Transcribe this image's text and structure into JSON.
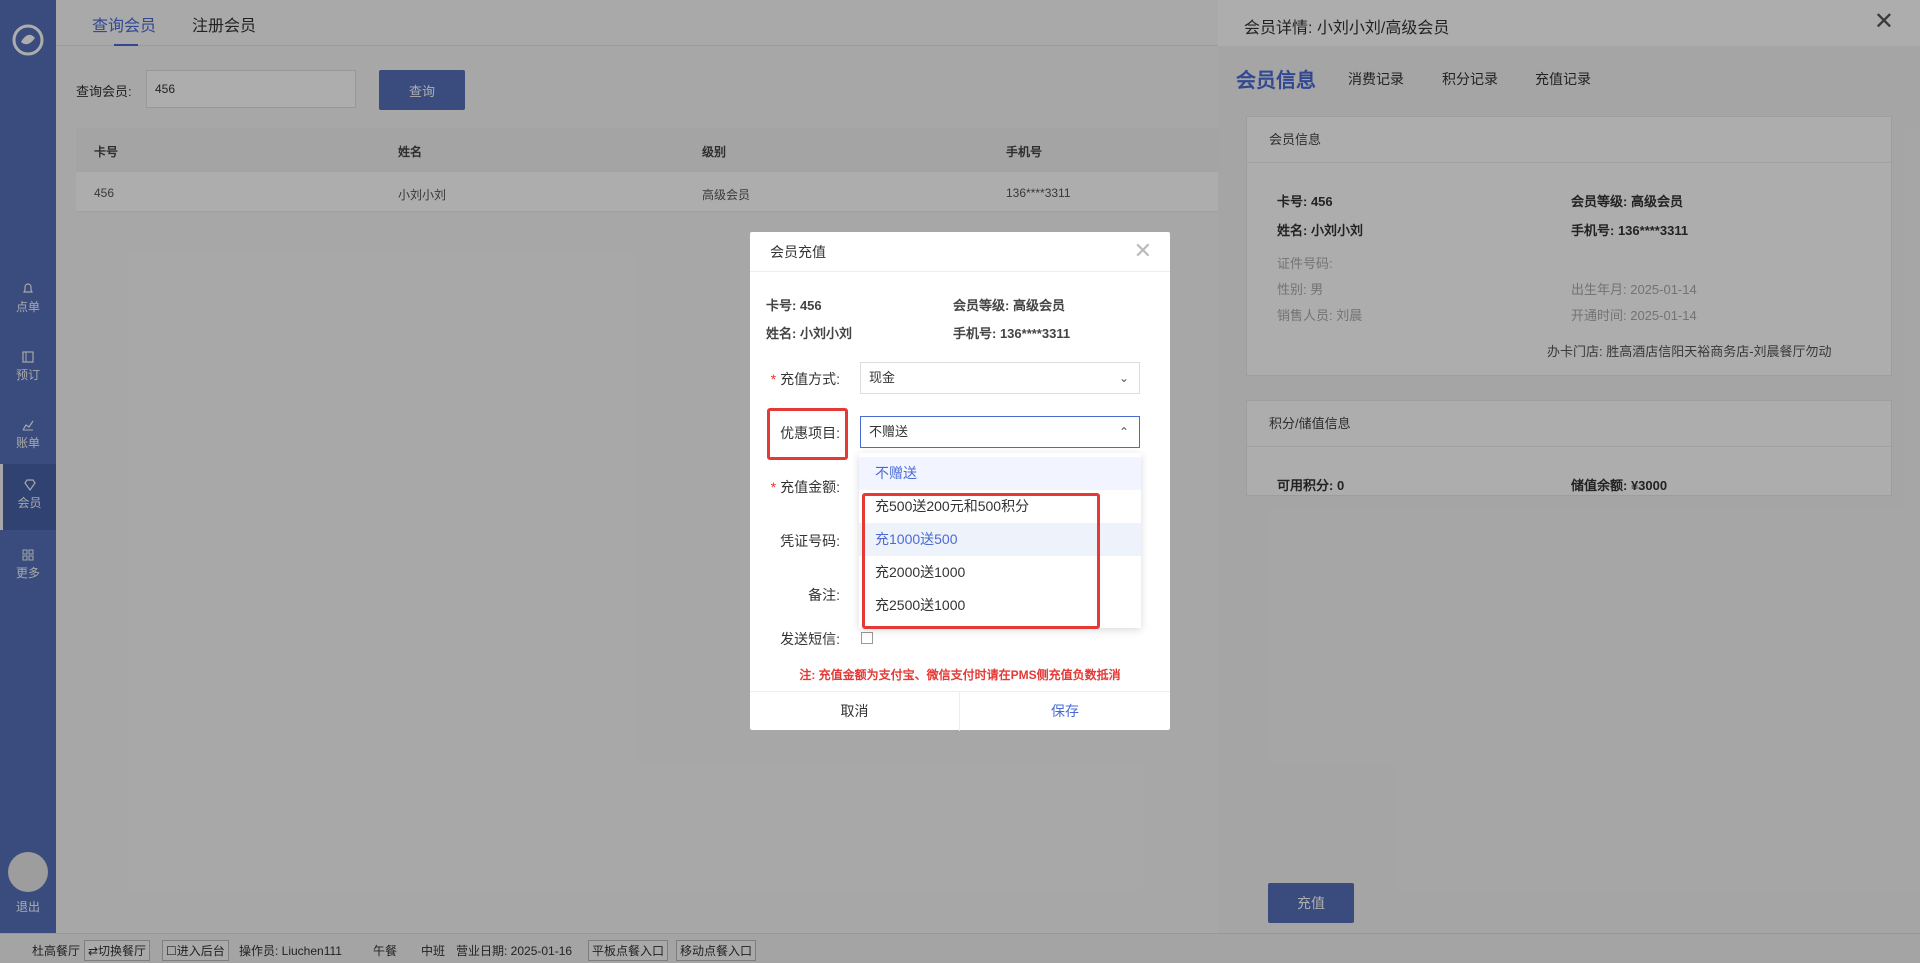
{
  "sidebar": {
    "items": [
      {
        "label": "点单",
        "icon": "bell-icon"
      },
      {
        "label": "预订",
        "icon": "book-icon"
      },
      {
        "label": "账单",
        "icon": "chart-icon"
      },
      {
        "label": "会员",
        "icon": "diamond-icon"
      },
      {
        "label": "更多",
        "icon": "grid-icon"
      }
    ],
    "logout_label": "退出"
  },
  "main": {
    "tabs": [
      "查询会员",
      "注册会员"
    ],
    "search_label": "查询会员:",
    "search_value": "456",
    "query_button": "查询",
    "table": {
      "headers": [
        "卡号",
        "姓名",
        "级别",
        "手机号"
      ],
      "rows": [
        [
          "456",
          "小刘小刘",
          "高级会员",
          "136****3311"
        ]
      ]
    }
  },
  "panel": {
    "title": "会员详情: 小刘小刘/高级会员",
    "close": "✕",
    "tabs": [
      "会员信息",
      "消费记录",
      "积分记录",
      "充值记录"
    ],
    "info_card_title": "会员信息",
    "card_no": "卡号: 456",
    "level": "会员等级: 高级会员",
    "name": "姓名: 小刘小刘",
    "phone": "手机号: 136****3311",
    "id_no": "证件号码:",
    "gender": "性别: 男",
    "birth": "出生年月: 2025-01-14",
    "salesperson": "销售人员: 刘晨",
    "open_date": "开通时间: 2025-01-14",
    "store": "办卡门店: 胜高酒店信阳天裕商务店-刘晨餐厅勿动",
    "points_card_title": "积分/储值信息",
    "points": "可用积分: 0",
    "balance": "储值余额: ¥3000",
    "recharge_button": "充值"
  },
  "footer": {
    "restaurant": "杜高餐厅",
    "switch": "⇄切换餐厅",
    "backend": "☐进入后台",
    "operator": "操作员: Liuchen111",
    "meal": "午餐",
    "shift": "中班",
    "business_date": "营业日期: 2025-01-16",
    "tablet": "平板点餐入口",
    "mobile": "移动点餐入口"
  },
  "modal": {
    "title": "会员充值",
    "close": "✕",
    "card_no": "卡号: 456",
    "level": "会员等级: 高级会员",
    "name": "姓名: 小刘小刘",
    "phone": "手机号: 136****3311",
    "pay_method_label": "充值方式:",
    "pay_method_value": "现金",
    "promo_label": "优惠项目:",
    "promo_value": "不赠送",
    "amount_label": "充值金额:",
    "voucher_label": "凭证号码:",
    "remark_label": "备注:",
    "sms_label": "发送短信:",
    "sms_checked": false,
    "note": "注: 充值金额为支付宝、微信支付时请在PMS侧充值负数抵消",
    "cancel": "取消",
    "save": "保存",
    "promo_options": [
      "不赠送",
      "充500送200元和500积分",
      "充1000送500",
      "充2000送1000",
      "充2500送1000"
    ],
    "selected_option": "不赠送",
    "highlighted_option": "充1000送500"
  },
  "colors": {
    "primary": "#5570b8",
    "accent": "#4a6bd6",
    "highlight_box": "#e53935"
  }
}
